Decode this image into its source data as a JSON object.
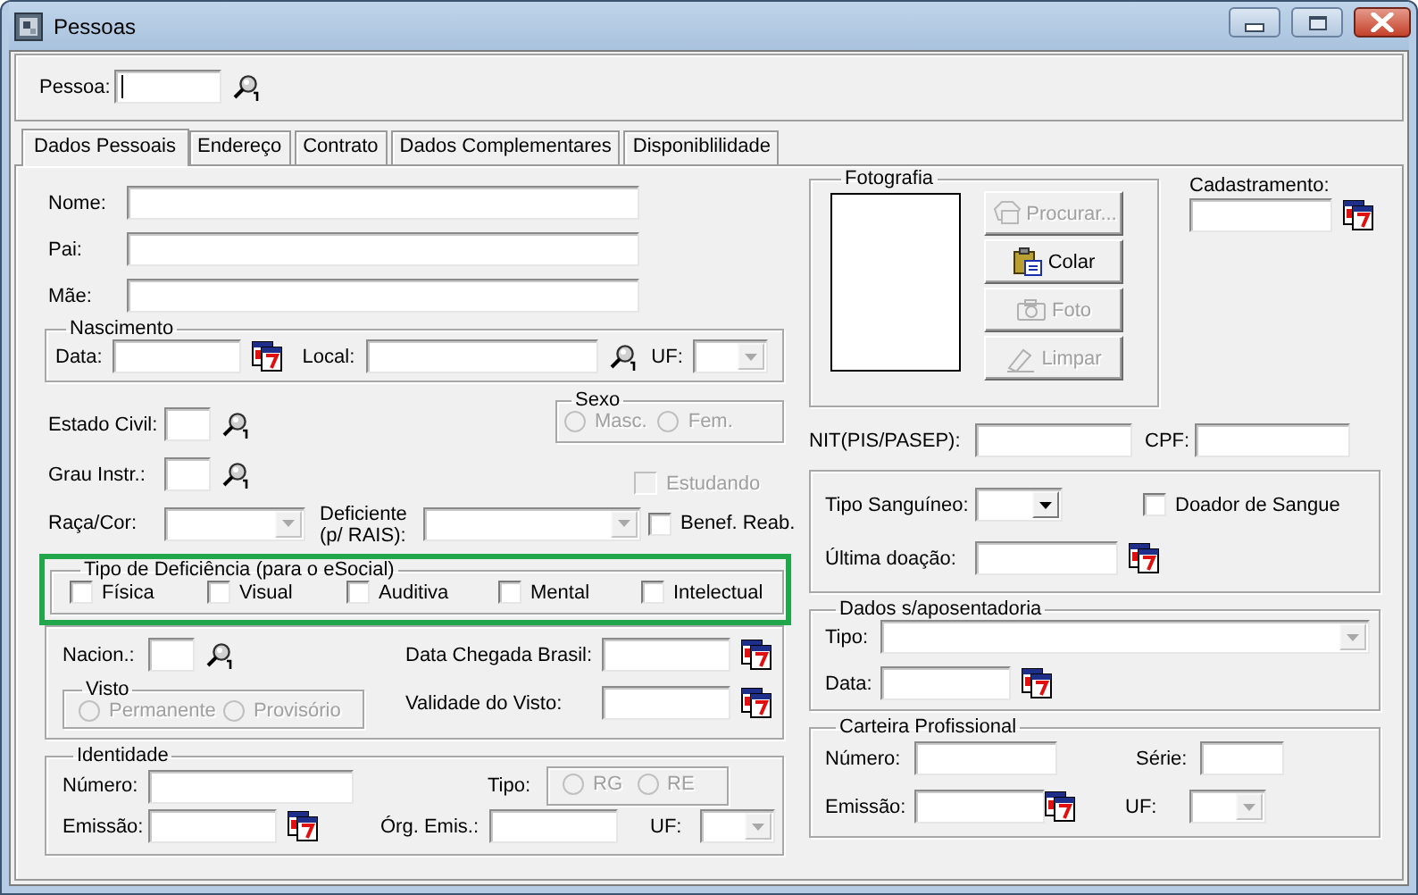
{
  "window": {
    "title": "Pessoas"
  },
  "pessoa": {
    "label": "Pessoa:",
    "focused": true
  },
  "tabs": [
    {
      "label": "Dados Pessoais",
      "selected": true
    },
    {
      "label": "Endereço",
      "selected": false
    },
    {
      "label": "Contrato",
      "selected": false
    },
    {
      "label": "Dados Complementares",
      "selected": false
    },
    {
      "label": "Disponiblilidade",
      "selected": false
    }
  ],
  "nome": {
    "label": "Nome:"
  },
  "pai": {
    "label": "Pai:"
  },
  "mae": {
    "label": "Mãe:"
  },
  "nascimento": {
    "title": "Nascimento",
    "data_label": "Data:",
    "local_label": "Local:",
    "uf": {
      "label": "UF:",
      "disabled": true
    }
  },
  "estado_civil": {
    "label": "Estado Civil:"
  },
  "sexo": {
    "title": "Sexo",
    "options": [
      {
        "label": "Masc.",
        "selected": false,
        "disabled": true
      },
      {
        "label": "Fem.",
        "selected": false,
        "disabled": true
      }
    ]
  },
  "grau_instr": {
    "label": "Grau Instr.:"
  },
  "estudando": {
    "label": "Estudando",
    "checked": false,
    "disabled": true
  },
  "raca_cor": {
    "label": "Raça/Cor:",
    "disabled": true
  },
  "deficiente": {
    "label": "Deficiente (p/ RAIS):",
    "disabled": true
  },
  "benef_reab": {
    "label": "Benef. Reab.",
    "checked": false,
    "disabled": false
  },
  "tipo_deficiencia": {
    "title": "Tipo de Deficiência (para o eSocial)",
    "highlighted": true,
    "options": [
      {
        "label": "Física",
        "checked": false
      },
      {
        "label": "Visual",
        "checked": false
      },
      {
        "label": "Auditiva",
        "checked": false
      },
      {
        "label": "Mental",
        "checked": false
      },
      {
        "label": "Intelectual",
        "checked": false
      }
    ]
  },
  "estrangeiro": {
    "nacion_label": "Nacion.:",
    "chegada_label": "Data Chegada Brasil:",
    "validade_label": "Validade do Visto:",
    "visto": {
      "title": "Visto",
      "options": [
        {
          "label": "Permanente",
          "selected": false,
          "disabled": true
        },
        {
          "label": "Provisório",
          "selected": false,
          "disabled": true
        }
      ]
    }
  },
  "identidade": {
    "title": "Identidade",
    "numero_label": "Número:",
    "tipo_label": "Tipo:",
    "tipo_options": [
      {
        "label": "RG",
        "selected": false,
        "disabled": true
      },
      {
        "label": "RE",
        "selected": false,
        "disabled": true
      }
    ],
    "emissao_label": "Emissão:",
    "orgao_label": "Órg. Emis.:",
    "uf": {
      "label": "UF:",
      "disabled": true
    }
  },
  "fotografia": {
    "title": "Fotografia",
    "buttons": [
      {
        "kind": "browse",
        "label": "Procurar...",
        "disabled": true
      },
      {
        "kind": "paste",
        "label": "Colar",
        "disabled": false
      },
      {
        "kind": "camera",
        "label": "Foto",
        "disabled": true
      },
      {
        "kind": "clear",
        "label": "Limpar",
        "disabled": true
      }
    ]
  },
  "cadastramento": {
    "label": "Cadastramento:"
  },
  "nit": {
    "label": "NIT(PIS/PASEP):"
  },
  "cpf": {
    "label": "CPF:"
  },
  "sangue": {
    "tipo": {
      "label": "Tipo Sanguíneo:",
      "disabled": false
    },
    "doador": {
      "label": "Doador de Sangue",
      "checked": false,
      "disabled": false
    },
    "ultima_label": "Última doação:"
  },
  "aposentadoria": {
    "title": "Dados s/aposentadoria",
    "tipo": {
      "label": "Tipo:",
      "disabled": true
    },
    "data_label": "Data:"
  },
  "carteira": {
    "title": "Carteira Profissional",
    "numero_label": "Número:",
    "serie_label": "Série:",
    "emissao_label": "Emissão:",
    "uf": {
      "label": "UF:",
      "disabled": true
    }
  }
}
